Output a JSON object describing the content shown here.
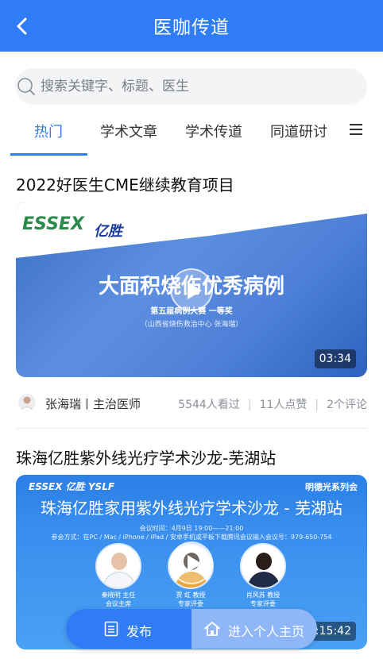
{
  "header": {
    "title": "医咖传道"
  },
  "search": {
    "placeholder": "搜索关键字、标题、医生"
  },
  "tabs": [
    {
      "label": "热门",
      "active": true
    },
    {
      "label": "学术文章",
      "active": false
    },
    {
      "label": "学术传道",
      "active": false
    },
    {
      "label": "同道研讨",
      "active": false
    }
  ],
  "colors": {
    "accent": "#2f7cf6",
    "home_button": "#8fb6f6"
  },
  "cards": [
    {
      "title": "2022好医生CME继续教育项目",
      "thumbnail": {
        "logo": "ESSEX",
        "logo_cn": "亿胜",
        "headline": "大面积烧伤优秀病例",
        "line1": "第五届病例大赛   一等奖",
        "line2": "（山西省烧伤救治中心      张海瑞）"
      },
      "duration": "03:34",
      "author": "张海瑞丨主治医师",
      "views": "5544人看过",
      "likes": "11人点赞",
      "comments": "2个评论"
    },
    {
      "title": "珠海亿胜紫外线光疗学术沙龙-芜湖站",
      "thumbnail": {
        "logos": "ESSEX 亿胜    YSLF",
        "series": "明德光系列会",
        "headline": "珠海亿胜家用紫外线光疗学术沙龙 - 芜湖站",
        "info1": "会议时间：4月9日  19:00——21:00",
        "info2": "参会方式：在PC / Mac / iPhone / iPad / 安卓手机或平板下载腾讯会议输入会议号：979-650-754",
        "speakers": [
          {
            "name": "秦晓明  主任",
            "role": "会议主席"
          },
          {
            "name": "贾   虹  教授",
            "role": "专家评委"
          },
          {
            "name": "肖风苏  教授",
            "role": "专家评委"
          }
        ]
      },
      "duration": "2:15:42"
    }
  ],
  "bottom_bar": {
    "publish_label": "发布",
    "home_label": "进入个人主页"
  }
}
